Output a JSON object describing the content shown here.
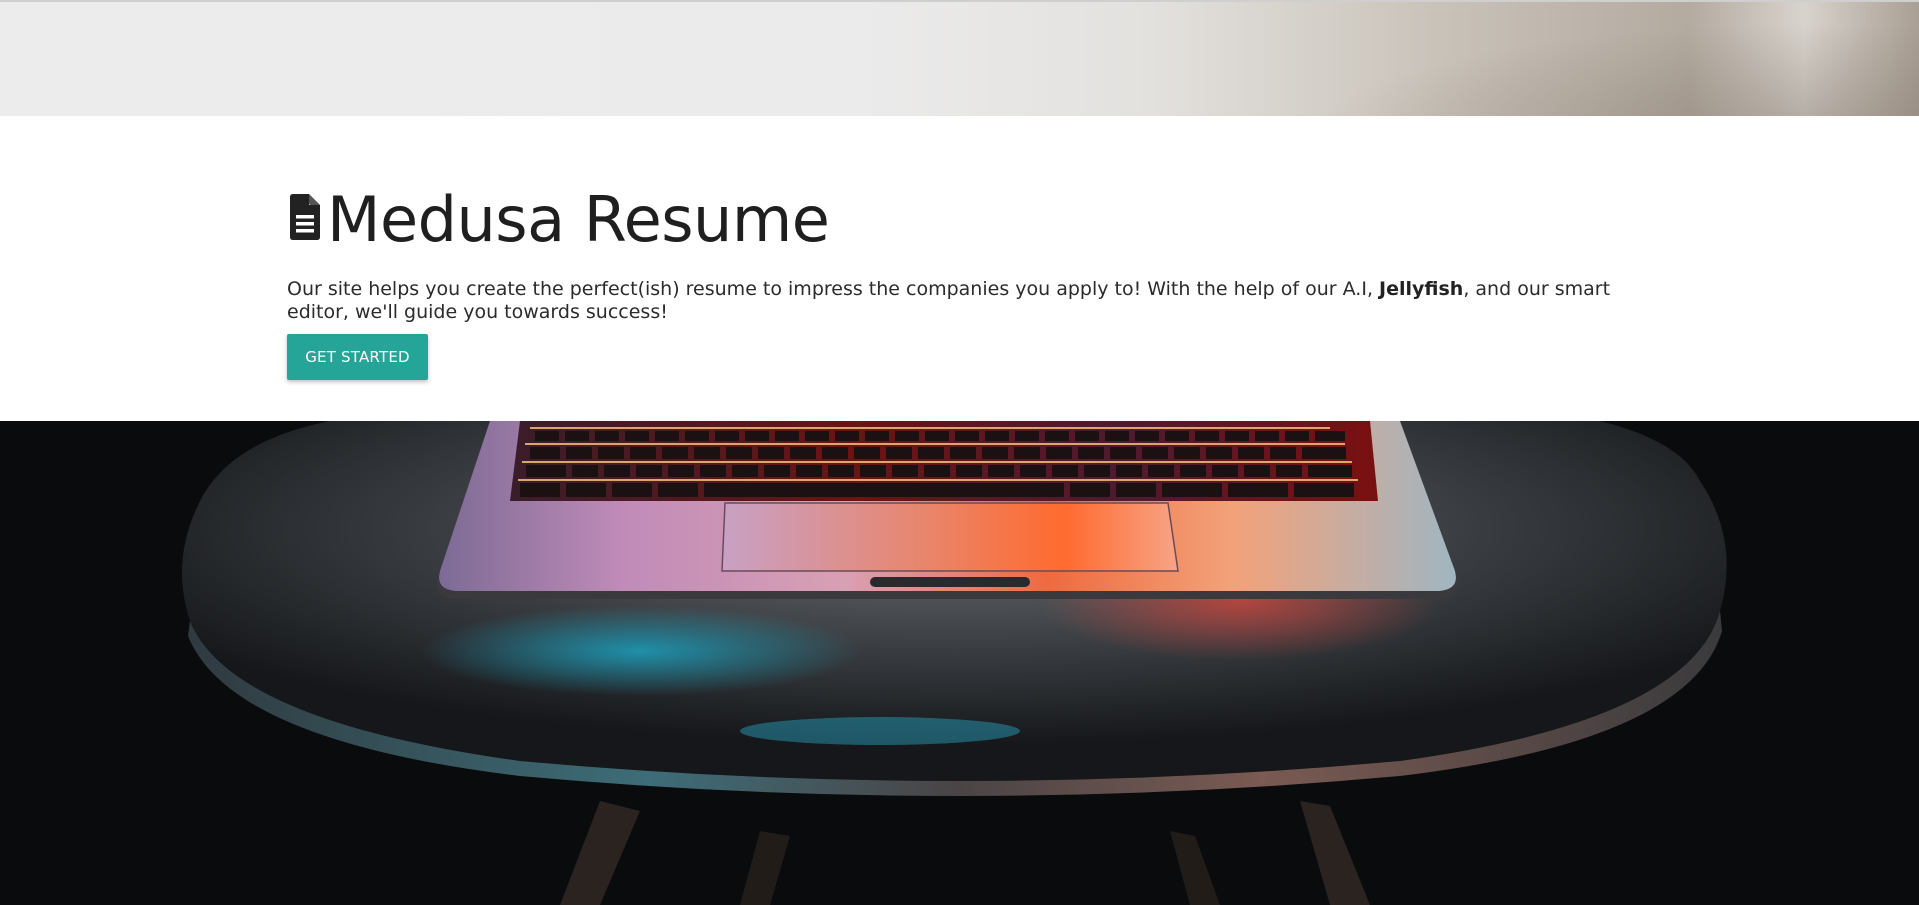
{
  "hero": {
    "title": "Medusa Resume",
    "description_before": "Our site helps you create the perfect(ish) resume to impress the companies you apply to! With the help of our A.I, ",
    "description_bold": "Jellyfish",
    "description_after": ", and our smart editor, we'll guide you towards success!",
    "cta_label": "GET STARTED",
    "icon": "file-document-icon"
  },
  "colors": {
    "accent": "#25a598",
    "title_text": "#1f1f1f",
    "body_text": "#2b2b2b",
    "hero_background": "#ffffff"
  },
  "images": {
    "top_banner": "background-photo-top",
    "bottom_banner": "laptop-on-chair-photo"
  }
}
